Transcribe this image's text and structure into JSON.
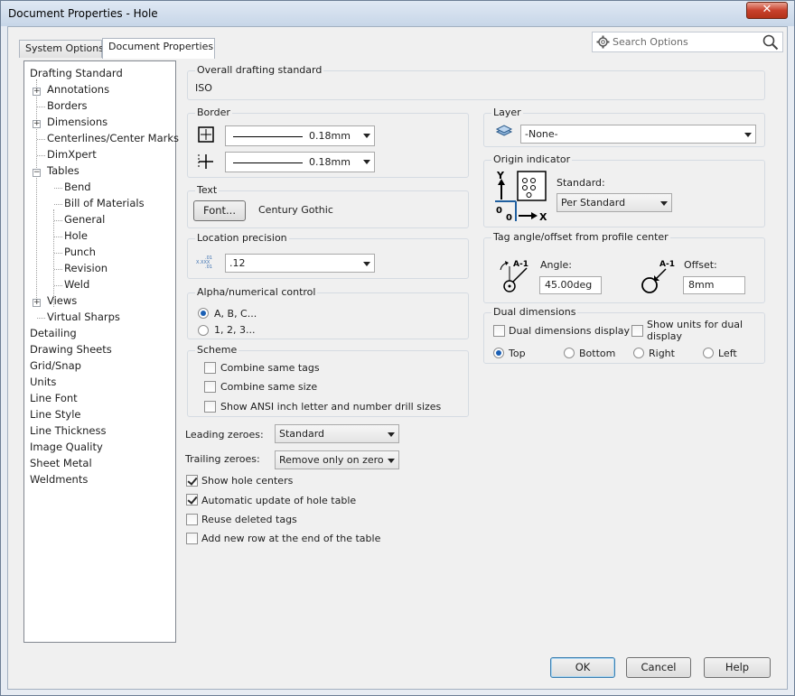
{
  "window": {
    "title": "Document Properties - Hole",
    "close": "✕"
  },
  "tabs": [
    "System Options",
    "Document Properties"
  ],
  "search": {
    "placeholder": "Search Options"
  },
  "tree": {
    "items": [
      "Drafting Standard",
      "Annotations",
      "Borders",
      "Dimensions",
      "Centerlines/Center Marks",
      "DimXpert",
      "Tables",
      "Bend",
      "Bill of Materials",
      "General",
      "Hole",
      "Punch",
      "Revision",
      "Weld",
      "Views",
      "Virtual Sharps",
      "Detailing",
      "Drawing Sheets",
      "Grid/Snap",
      "Units",
      "Line Font",
      "Line Style",
      "Line Thickness",
      "Image Quality",
      "Sheet Metal",
      "Weldments"
    ]
  },
  "overall": {
    "label": "Overall drafting standard",
    "value": "ISO"
  },
  "border": {
    "label": "Border",
    "thickness1": "0.18mm",
    "thickness2": "0.18mm"
  },
  "text": {
    "label": "Text",
    "font_button": "Font...",
    "font_name": "Century Gothic"
  },
  "location": {
    "label": "Location precision",
    "value": ".12"
  },
  "alpha": {
    "label": "Alpha/numerical control",
    "opt1": "A, B, C...",
    "opt2": "1, 2, 3..."
  },
  "scheme": {
    "label": "Scheme",
    "c1": "Combine same tags",
    "c2": "Combine same size",
    "c3": "Show ANSI inch letter and number drill sizes"
  },
  "zeroes": {
    "leading_label": "Leading zeroes:",
    "leading_value": "Standard",
    "trailing_label": "Trailing zeroes:",
    "trailing_value": "Remove only on zero"
  },
  "options": {
    "o1": "Show hole centers",
    "o2": "Automatic update of hole table",
    "o3": "Reuse deleted tags",
    "o4": "Add new row at the end of the table"
  },
  "layer": {
    "label": "Layer",
    "value": "-None-"
  },
  "origin": {
    "label": "Origin indicator",
    "standard_label": "Standard:",
    "standard_value": "Per Standard"
  },
  "tag": {
    "label": "Tag angle/offset from profile center",
    "angle_label": "Angle:",
    "angle_value": "45.00deg",
    "offset_label": "Offset:",
    "offset_value": "8mm"
  },
  "dual": {
    "label": "Dual dimensions",
    "display": "Dual dimensions display",
    "show_units": "Show units for dual display",
    "top": "Top",
    "bottom": "Bottom",
    "right": "Right",
    "left": "Left"
  },
  "buttons": {
    "ok": "OK",
    "cancel": "Cancel",
    "help": "Help"
  }
}
